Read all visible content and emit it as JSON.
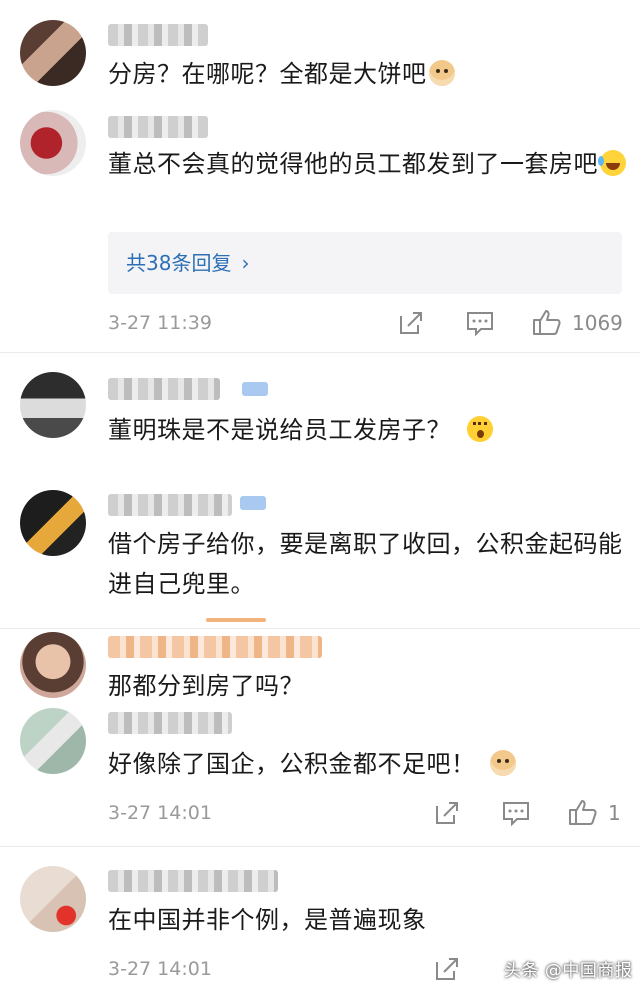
{
  "comments": [
    {
      "text": "分房？在哪呢？全都是大饼吧",
      "emoji": "doge-emoji"
    },
    {
      "text": "董总不会真的觉得他的员工都发到了一套房吧",
      "emoji": "laugh-cry-emoji",
      "replies_label": "共38条回复",
      "time": "3-27 11:39",
      "likes": "1069"
    },
    {
      "text": "董明珠是不是说给员工发房子？",
      "emoji": "surprised-emoji"
    },
    {
      "text": "借个房子给你，要是离职了收回，公积金起码能进自己兜里。",
      "emoji": ""
    },
    {
      "text": "那都分到房了吗？",
      "emoji": ""
    },
    {
      "text": "好像除了国企，公积金都不足吧！",
      "emoji": "doge-emoji",
      "time": "3-27 14:01",
      "likes": "1"
    },
    {
      "text": "在中国并非个例，是普遍现象",
      "emoji": "",
      "time": "3-27 14:01"
    }
  ],
  "icons": {
    "share": "share-icon",
    "comment": "comment-icon",
    "like": "thumbs-up-icon"
  },
  "colors": {
    "link": "#2d6fb5",
    "meta": "#9a9a9a",
    "reply_bg": "#f4f4f6"
  },
  "watermark": "头条 @中国商报"
}
